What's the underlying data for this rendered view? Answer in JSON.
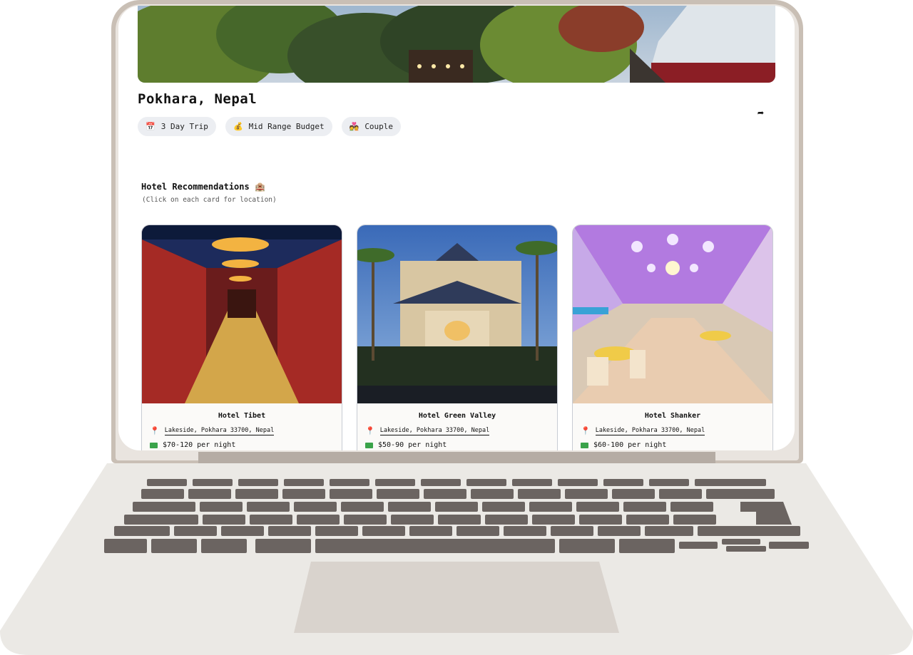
{
  "trip": {
    "location": "Pokhara, Nepal",
    "share_icon": "share-icon",
    "chips": [
      {
        "icon": "calendar-icon",
        "glyph": "📅",
        "label": "3 Day Trip"
      },
      {
        "icon": "money-bag-icon",
        "glyph": "💰",
        "label": "Mid Range Budget"
      },
      {
        "icon": "couple-icon",
        "glyph": "💑",
        "label": "Couple"
      }
    ]
  },
  "hotels_section": {
    "title": "Hotel Recommendations 🏨",
    "subtitle": "(Click on each card for location)"
  },
  "hotels": [
    {
      "name": "Hotel Tibet",
      "address": "Lakeside, Pokhara 33700, Nepal",
      "price": "$70-120 per night"
    },
    {
      "name": "Hotel Green Valley",
      "address": "Lakeside, Pokhara 33700, Nepal",
      "price": "$50-90 per night"
    },
    {
      "name": "Hotel Shanker",
      "address": "Lakeside, Pokhara 33700, Nepal",
      "price": "$60-100 per night"
    }
  ],
  "colors": {
    "chip_bg": "#eceef2",
    "pin": "#e23d6b",
    "money": "#3aa34a",
    "laptop_shell": "#c9bfb5",
    "keys": "#6b6461"
  }
}
